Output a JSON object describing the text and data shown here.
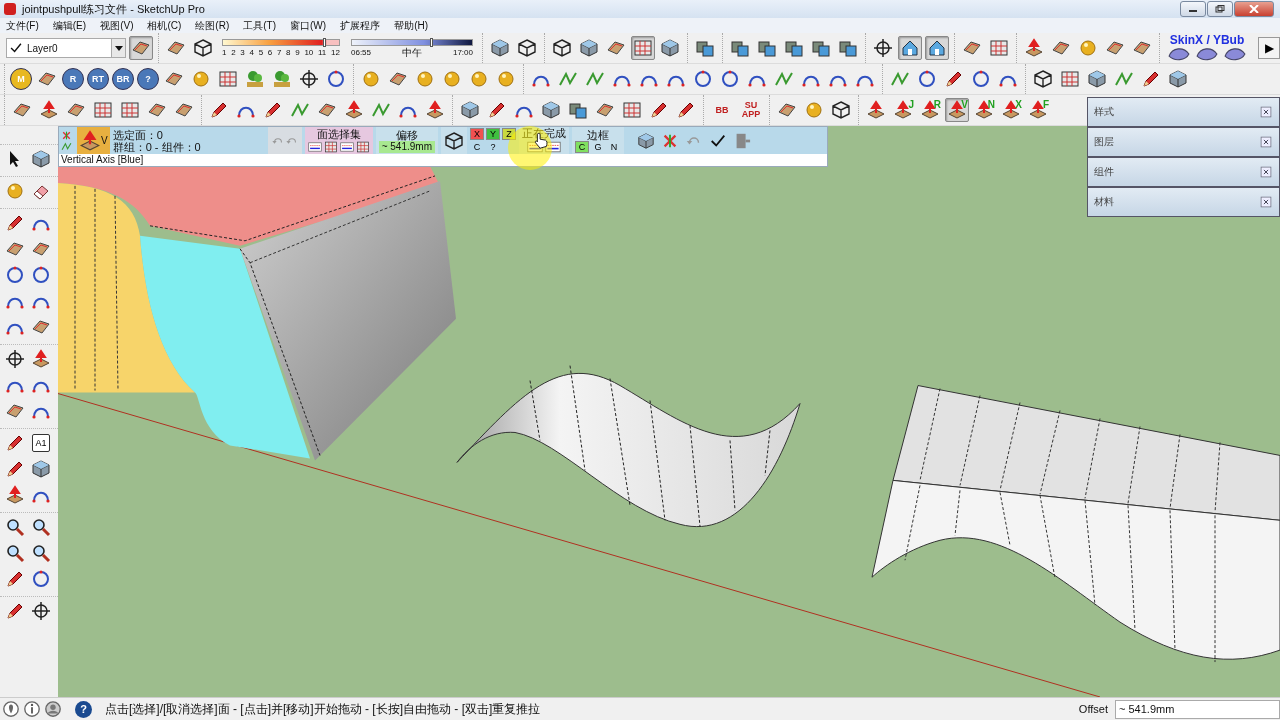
{
  "window": {
    "title": "jointpushpull练习文件 - SketchUp Pro"
  },
  "menu": [
    "文件(F)",
    "编辑(E)",
    "视图(V)",
    "相机(C)",
    "绘图(R)",
    "工具(T)",
    "窗口(W)",
    "扩展程序",
    "帮助(H)"
  ],
  "row1": {
    "layer": "Layer0",
    "lead": [
      {
        "kind": "face",
        "selected": false
      },
      {
        "kind": "wire",
        "selected": false
      }
    ],
    "shadow": {
      "hours": [
        "1",
        "2",
        "3",
        "4",
        "5",
        "6",
        "7",
        "8",
        "9",
        "10",
        "11",
        "12"
      ],
      "level": 0.87
    },
    "time": {
      "start": "06:55",
      "middle": "中午",
      "end": "17:00",
      "level": 0.66
    },
    "groups": [
      [
        {
          "kind": "cube",
          "selected": false
        },
        {
          "kind": "wire",
          "selected": false
        }
      ],
      [
        {
          "kind": "wire",
          "selected": false
        },
        {
          "kind": "cube",
          "selected": false
        },
        {
          "kind": "face",
          "selected": false
        },
        {
          "kind": "grid",
          "selected": true
        },
        {
          "kind": "cube",
          "selected": false
        }
      ],
      [
        {
          "kind": "squares",
          "selected": false
        }
      ],
      [
        {
          "kind": "squares",
          "selected": false
        },
        {
          "kind": "squares",
          "selected": false
        },
        {
          "kind": "squares",
          "selected": false
        },
        {
          "kind": "squares",
          "selected": false
        },
        {
          "kind": "squares",
          "selected": false
        }
      ],
      [
        {
          "kind": "crosshair",
          "selected": false
        },
        {
          "kind": "house",
          "selected": true
        },
        {
          "kind": "house",
          "selected": true
        }
      ],
      [
        {
          "kind": "face",
          "selected": false
        },
        {
          "kind": "grid",
          "selected": false
        }
      ],
      [
        {
          "kind": "push",
          "selected": false
        },
        {
          "kind": "face",
          "selected": false
        },
        {
          "kind": "ball",
          "selected": false
        },
        {
          "kind": "face",
          "selected": false
        },
        {
          "kind": "face",
          "selected": false
        }
      ]
    ],
    "skin_label": "SkinX / YBub",
    "more": "▶"
  },
  "row2": [
    [
      {
        "kind": "badge",
        "text": "M",
        "color": "#e8b820"
      },
      {
        "kind": "face"
      },
      {
        "kind": "badge",
        "text": "R",
        "color": "#4a78b8"
      },
      {
        "kind": "badge",
        "text": "RT",
        "color": "#4a78b8"
      },
      {
        "kind": "badge",
        "text": "BR",
        "color": "#4a78b8"
      },
      {
        "kind": "badge",
        "text": "?",
        "color": "#4a78b8"
      },
      {
        "kind": "face"
      },
      {
        "kind": "ball"
      },
      {
        "kind": "grid"
      },
      {
        "kind": "tree"
      },
      {
        "kind": "tree"
      },
      {
        "kind": "crosshair"
      },
      {
        "kind": "circle"
      }
    ],
    [
      {
        "kind": "ball"
      },
      {
        "kind": "face"
      },
      {
        "kind": "ball"
      },
      {
        "kind": "ball"
      },
      {
        "kind": "ball"
      },
      {
        "kind": "ball"
      }
    ],
    [
      {
        "kind": "arc"
      },
      {
        "kind": "zigzag"
      },
      {
        "kind": "zigzag"
      },
      {
        "kind": "arc"
      },
      {
        "kind": "arc"
      },
      {
        "kind": "arc"
      },
      {
        "kind": "circle"
      },
      {
        "kind": "circle"
      },
      {
        "kind": "arc"
      },
      {
        "kind": "zigzag"
      },
      {
        "kind": "arc"
      },
      {
        "kind": "arc"
      },
      {
        "kind": "arc"
      }
    ],
    [
      {
        "kind": "zigzag"
      },
      {
        "kind": "circle"
      },
      {
        "kind": "pencil"
      },
      {
        "kind": "circle"
      },
      {
        "kind": "arc"
      }
    ],
    [
      {
        "kind": "wire"
      },
      {
        "kind": "grid"
      },
      {
        "kind": "cube"
      },
      {
        "kind": "zigzag"
      },
      {
        "kind": "pencil"
      },
      {
        "kind": "cube"
      }
    ]
  ],
  "row3": [
    [
      {
        "kind": "face"
      },
      {
        "kind": "push"
      },
      {
        "kind": "face"
      },
      {
        "kind": "grid"
      },
      {
        "kind": "grid"
      },
      {
        "kind": "face"
      },
      {
        "kind": "face"
      }
    ],
    [
      {
        "kind": "pencil"
      },
      {
        "kind": "arc"
      },
      {
        "kind": "pencil"
      },
      {
        "kind": "zigzag"
      },
      {
        "kind": "face"
      },
      {
        "kind": "push"
      },
      {
        "kind": "zigzag"
      },
      {
        "kind": "arc"
      },
      {
        "kind": "push"
      }
    ],
    [
      {
        "kind": "cube"
      },
      {
        "kind": "pencil"
      },
      {
        "kind": "arc"
      },
      {
        "kind": "cube"
      },
      {
        "kind": "squares"
      },
      {
        "kind": "face"
      },
      {
        "kind": "grid"
      },
      {
        "kind": "pencil"
      },
      {
        "kind": "pencil"
      }
    ],
    [
      {
        "kind": "logo",
        "text": "BB"
      },
      {
        "kind": "logo",
        "text": "SU APP"
      }
    ],
    [
      {
        "kind": "face"
      },
      {
        "kind": "ball"
      },
      {
        "kind": "wire"
      }
    ],
    [
      {
        "kind": "push",
        "selected": false
      },
      {
        "kind": "pushlabel",
        "text": "J",
        "selected": false
      },
      {
        "kind": "pushlabel",
        "text": "R",
        "selected": false
      },
      {
        "kind": "pushlabel",
        "text": "V",
        "selected": true
      },
      {
        "kind": "pushlabel",
        "text": "N",
        "selected": false
      },
      {
        "kind": "pushlabel",
        "text": "X",
        "selected": false
      },
      {
        "kind": "pushlabel",
        "text": "F",
        "selected": false
      }
    ]
  ],
  "left_toolbar": [
    [
      [
        {
          "kind": "cursor"
        },
        {
          "kind": "cube"
        }
      ]
    ],
    [
      [
        {
          "kind": "ball"
        },
        {
          "kind": "eraser"
        }
      ]
    ],
    [
      [
        {
          "kind": "pencil"
        },
        {
          "kind": "arc"
        }
      ],
      [
        {
          "kind": "face"
        },
        {
          "kind": "face"
        }
      ],
      [
        {
          "kind": "circle"
        },
        {
          "kind": "circle"
        }
      ],
      [
        {
          "kind": "arc"
        },
        {
          "kind": "arc"
        }
      ],
      [
        {
          "kind": "arc"
        },
        {
          "kind": "face"
        }
      ]
    ],
    [
      [
        {
          "kind": "crosshair"
        },
        {
          "kind": "push"
        }
      ],
      [
        {
          "kind": "arc"
        },
        {
          "kind": "arc"
        }
      ],
      [
        {
          "kind": "face"
        },
        {
          "kind": "arc"
        }
      ]
    ],
    [
      [
        {
          "kind": "pencil"
        },
        {
          "kind": "textbox",
          "text": "A1"
        }
      ],
      [
        {
          "kind": "pencil"
        },
        {
          "kind": "cube"
        }
      ],
      [
        {
          "kind": "push"
        },
        {
          "kind": "arc"
        }
      ]
    ],
    [
      [
        {
          "kind": "magnifier"
        },
        {
          "kind": "magnifier"
        }
      ],
      [
        {
          "kind": "magnifier"
        },
        {
          "kind": "magnifier"
        }
      ],
      [
        {
          "kind": "pencil"
        },
        {
          "kind": "circle"
        }
      ]
    ],
    [
      [
        {
          "kind": "pencil"
        },
        {
          "kind": "crosshair"
        }
      ]
    ]
  ],
  "plugin": {
    "v_label": "V",
    "selected_faces": "选定面：0",
    "group_count": "群组：0 - 组件：0",
    "face_set": "面选择集",
    "offset_title": "偏移",
    "offset_value": "~ 541.9mm",
    "axes": [
      {
        "label": "X",
        "color": "#f05050"
      },
      {
        "label": "Y",
        "color": "#40c040"
      },
      {
        "label": "Z",
        "color": "#c8d840"
      }
    ],
    "lower": [
      "C",
      "?"
    ],
    "finish": "正在完成",
    "border": "边框",
    "border_modes": [
      {
        "label": "C",
        "selected": true
      },
      {
        "label": "G",
        "selected": false
      },
      {
        "label": "N",
        "selected": false
      }
    ],
    "hint": "Vertical Axis [Blue]"
  },
  "tray": [
    "样式",
    "图层",
    "组件",
    "材料"
  ],
  "status": {
    "help": "?",
    "message": "点击[选择]/[取消选择]面 - [点击]并[移动]开始拖动 - [长按]自由拖动 - [双击]重复推拉",
    "measure_label": "Offset",
    "measure_value": "~ 541.9mm"
  }
}
